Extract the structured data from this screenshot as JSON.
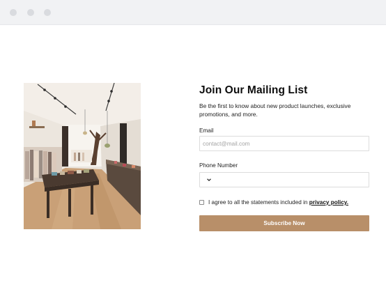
{
  "form": {
    "title": "Join Our Mailing List",
    "subtitle": "Be the first to know about new product launches, exclusive promotions, and more.",
    "email_label": "Email",
    "email_placeholder": "contact@mail.com",
    "email_value": "",
    "phone_label": "Phone Number",
    "phone_value": "",
    "agree_text": "I agree to all the statements included in",
    "agree_link": "privacy policy.",
    "agree_checked": false,
    "subscribe_label": "Subscribe Now"
  },
  "theme": {
    "accent": "#b88f69",
    "titlebar": "#f1f2f4",
    "dot": "#d9dbdf"
  },
  "icons": {
    "phone_country": "chevron-down-icon"
  }
}
